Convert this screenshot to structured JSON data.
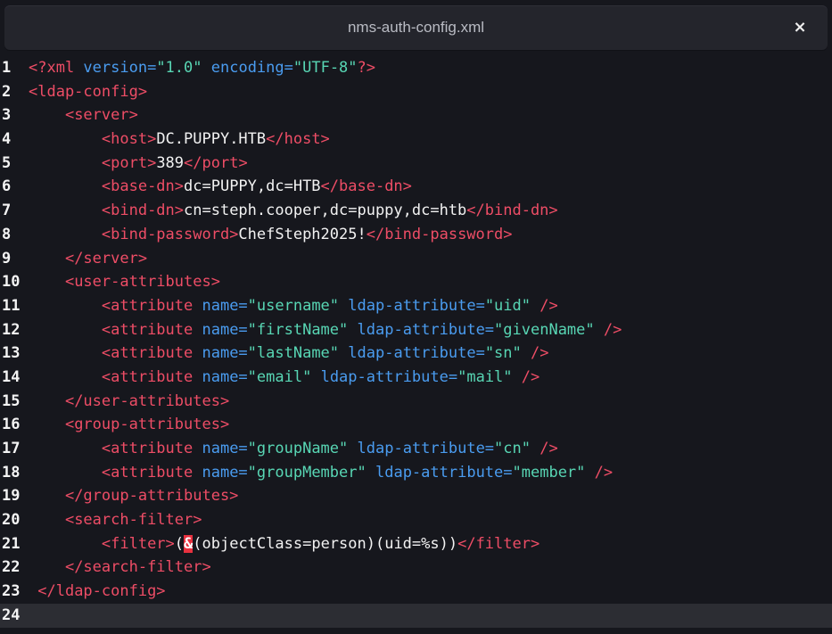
{
  "window": {
    "title": "nms-auth-config.xml",
    "close_glyph": "×",
    "close_icon": "close-icon"
  },
  "colors": {
    "background": "#16171d",
    "titlebar": "#24252c",
    "tag": "#ee4d66",
    "attribute": "#4a9cf0",
    "string": "#58d6b4",
    "text": "#f2f2f2",
    "current_line": "#2c2d33",
    "highlight": "#e8313f"
  },
  "editor": {
    "current_line": 24,
    "lines": [
      {
        "num": "1",
        "segs": [
          {
            "c": "t",
            "t": "<?xml "
          },
          {
            "c": "a",
            "t": "version="
          },
          {
            "c": "s",
            "t": "\"1.0\""
          },
          {
            "c": "x",
            "t": " "
          },
          {
            "c": "a",
            "t": "encoding="
          },
          {
            "c": "s",
            "t": "\"UTF-8\""
          },
          {
            "c": "t",
            "t": "?>"
          }
        ]
      },
      {
        "num": "2",
        "segs": [
          {
            "c": "t",
            "t": "<ldap-config>"
          }
        ]
      },
      {
        "num": "3",
        "segs": [
          {
            "c": "x",
            "t": "    "
          },
          {
            "c": "t",
            "t": "<server>"
          }
        ]
      },
      {
        "num": "4",
        "segs": [
          {
            "c": "x",
            "t": "        "
          },
          {
            "c": "t",
            "t": "<host>"
          },
          {
            "c": "x",
            "t": "DC.PUPPY.HTB"
          },
          {
            "c": "t",
            "t": "</host>"
          }
        ]
      },
      {
        "num": "5",
        "segs": [
          {
            "c": "x",
            "t": "        "
          },
          {
            "c": "t",
            "t": "<port>"
          },
          {
            "c": "x",
            "t": "389"
          },
          {
            "c": "t",
            "t": "</port>"
          }
        ]
      },
      {
        "num": "6",
        "segs": [
          {
            "c": "x",
            "t": "        "
          },
          {
            "c": "t",
            "t": "<base-dn>"
          },
          {
            "c": "x",
            "t": "dc=PUPPY,dc=HTB"
          },
          {
            "c": "t",
            "t": "</base-dn>"
          }
        ]
      },
      {
        "num": "7",
        "segs": [
          {
            "c": "x",
            "t": "        "
          },
          {
            "c": "t",
            "t": "<bind-dn>"
          },
          {
            "c": "x",
            "t": "cn=steph.cooper,dc=puppy,dc=htb"
          },
          {
            "c": "t",
            "t": "</bind-dn>"
          }
        ]
      },
      {
        "num": "8",
        "segs": [
          {
            "c": "x",
            "t": "        "
          },
          {
            "c": "t",
            "t": "<bind-password>"
          },
          {
            "c": "x",
            "t": "ChefSteph2025!"
          },
          {
            "c": "t",
            "t": "</bind-password>"
          }
        ]
      },
      {
        "num": "9",
        "segs": [
          {
            "c": "x",
            "t": "    "
          },
          {
            "c": "t",
            "t": "</server>"
          }
        ]
      },
      {
        "num": "10",
        "segs": [
          {
            "c": "x",
            "t": "    "
          },
          {
            "c": "t",
            "t": "<user-attributes>"
          }
        ]
      },
      {
        "num": "11",
        "segs": [
          {
            "c": "x",
            "t": "        "
          },
          {
            "c": "t",
            "t": "<attribute "
          },
          {
            "c": "a",
            "t": "name="
          },
          {
            "c": "s",
            "t": "\"username\""
          },
          {
            "c": "x",
            "t": " "
          },
          {
            "c": "a",
            "t": "ldap-attribute="
          },
          {
            "c": "s",
            "t": "\"uid\""
          },
          {
            "c": "x",
            "t": " "
          },
          {
            "c": "t",
            "t": "/>"
          }
        ]
      },
      {
        "num": "12",
        "segs": [
          {
            "c": "x",
            "t": "        "
          },
          {
            "c": "t",
            "t": "<attribute "
          },
          {
            "c": "a",
            "t": "name="
          },
          {
            "c": "s",
            "t": "\"firstName\""
          },
          {
            "c": "x",
            "t": " "
          },
          {
            "c": "a",
            "t": "ldap-attribute="
          },
          {
            "c": "s",
            "t": "\"givenName\""
          },
          {
            "c": "x",
            "t": " "
          },
          {
            "c": "t",
            "t": "/>"
          }
        ]
      },
      {
        "num": "13",
        "segs": [
          {
            "c": "x",
            "t": "        "
          },
          {
            "c": "t",
            "t": "<attribute "
          },
          {
            "c": "a",
            "t": "name="
          },
          {
            "c": "s",
            "t": "\"lastName\""
          },
          {
            "c": "x",
            "t": " "
          },
          {
            "c": "a",
            "t": "ldap-attribute="
          },
          {
            "c": "s",
            "t": "\"sn\""
          },
          {
            "c": "x",
            "t": " "
          },
          {
            "c": "t",
            "t": "/>"
          }
        ]
      },
      {
        "num": "14",
        "segs": [
          {
            "c": "x",
            "t": "        "
          },
          {
            "c": "t",
            "t": "<attribute "
          },
          {
            "c": "a",
            "t": "name="
          },
          {
            "c": "s",
            "t": "\"email\""
          },
          {
            "c": "x",
            "t": " "
          },
          {
            "c": "a",
            "t": "ldap-attribute="
          },
          {
            "c": "s",
            "t": "\"mail\""
          },
          {
            "c": "x",
            "t": " "
          },
          {
            "c": "t",
            "t": "/>"
          }
        ]
      },
      {
        "num": "15",
        "segs": [
          {
            "c": "x",
            "t": "    "
          },
          {
            "c": "t",
            "t": "</user-attributes>"
          }
        ]
      },
      {
        "num": "16",
        "segs": [
          {
            "c": "x",
            "t": "    "
          },
          {
            "c": "t",
            "t": "<group-attributes>"
          }
        ]
      },
      {
        "num": "17",
        "segs": [
          {
            "c": "x",
            "t": "        "
          },
          {
            "c": "t",
            "t": "<attribute "
          },
          {
            "c": "a",
            "t": "name="
          },
          {
            "c": "s",
            "t": "\"groupName\""
          },
          {
            "c": "x",
            "t": " "
          },
          {
            "c": "a",
            "t": "ldap-attribute="
          },
          {
            "c": "s",
            "t": "\"cn\""
          },
          {
            "c": "x",
            "t": " "
          },
          {
            "c": "t",
            "t": "/>"
          }
        ]
      },
      {
        "num": "18",
        "segs": [
          {
            "c": "x",
            "t": "        "
          },
          {
            "c": "t",
            "t": "<attribute "
          },
          {
            "c": "a",
            "t": "name="
          },
          {
            "c": "s",
            "t": "\"groupMember\""
          },
          {
            "c": "x",
            "t": " "
          },
          {
            "c": "a",
            "t": "ldap-attribute="
          },
          {
            "c": "s",
            "t": "\"member\""
          },
          {
            "c": "x",
            "t": " "
          },
          {
            "c": "t",
            "t": "/>"
          }
        ]
      },
      {
        "num": "19",
        "segs": [
          {
            "c": "x",
            "t": "    "
          },
          {
            "c": "t",
            "t": "</group-attributes>"
          }
        ]
      },
      {
        "num": "20",
        "segs": [
          {
            "c": "x",
            "t": "    "
          },
          {
            "c": "t",
            "t": "<search-filter>"
          }
        ]
      },
      {
        "num": "21",
        "segs": [
          {
            "c": "x",
            "t": "        "
          },
          {
            "c": "t",
            "t": "<filter>"
          },
          {
            "c": "x",
            "t": "("
          },
          {
            "c": "amp",
            "t": "&"
          },
          {
            "c": "x",
            "t": "(objectClass=person)(uid=%s))"
          },
          {
            "c": "t",
            "t": "</filter>"
          }
        ]
      },
      {
        "num": "22",
        "segs": [
          {
            "c": "x",
            "t": "    "
          },
          {
            "c": "t",
            "t": "</search-filter>"
          }
        ]
      },
      {
        "num": "23",
        "segs": [
          {
            "c": "x",
            "t": " "
          },
          {
            "c": "t",
            "t": "</ldap-config>"
          }
        ]
      },
      {
        "num": "24",
        "segs": []
      }
    ]
  }
}
